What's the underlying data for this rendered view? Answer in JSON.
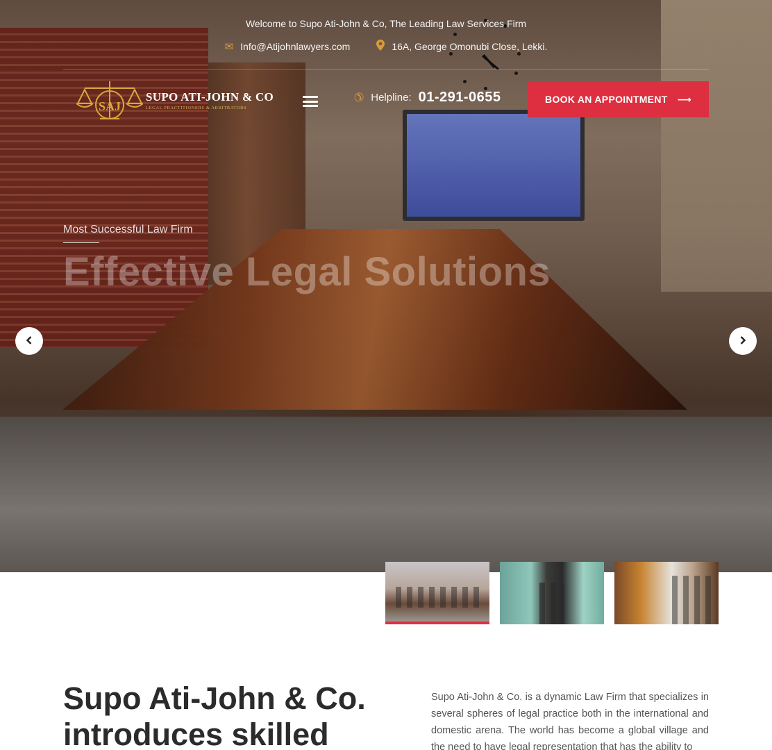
{
  "topbar": {
    "welcome": "Welcome to Supo Ati-John & Co, The Leading Law Services Firm",
    "email": "Info@Atijohnlawyers.com",
    "address": "16A, George Omonubi Close, Lekki.",
    "email_icon": "envelope-icon",
    "address_icon": "map-pin-icon"
  },
  "header": {
    "logo_title": "SUPO ATI-JOHN & CO",
    "logo_tagline": "LEGAL PRACTITIONERS & ARBITRATORS",
    "logo_monogram": "SAJ",
    "helpline_label": "Helpline:",
    "helpline_number": "01-291-0655",
    "book_button": "BOOK AN APPOINTMENT",
    "book_arrow": "⟶"
  },
  "slider": {
    "subtitle": "Most Successful Law Firm",
    "title": "Effective Legal Solutions",
    "prev_icon": "‹",
    "next_icon": "›"
  },
  "about": {
    "heading": "Supo Ati-John & Co. introduces skilled",
    "text": "Supo Ati-John & Co. is a dynamic Law Firm that specializes in several spheres of legal practice both in the international and domestic arena. The world has become a global village and the need to have legal representation that has the ability to"
  },
  "colors": {
    "accent": "#dd2f3f",
    "gold": "#d99a3a"
  }
}
